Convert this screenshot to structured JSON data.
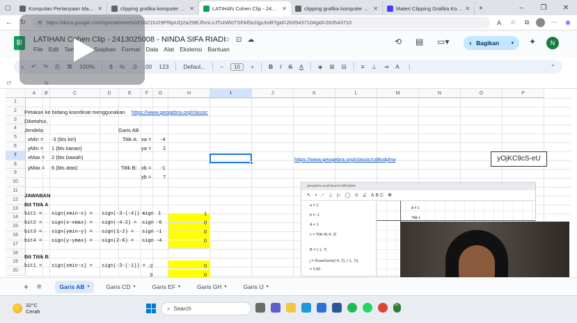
{
  "browser": {
    "tabs": [
      {
        "title": "Kumpulan Pertanyaan Materi",
        "color": "#5f6368"
      },
      {
        "title": "clipping grafika komputer - G",
        "color": "#5f6368"
      },
      {
        "title": "LATIHAN Cohen Clip - 24130",
        "color": "#0f9d58"
      },
      {
        "title": "clipping grafika komputer per",
        "color": "#5f6368"
      },
      {
        "title": "Materi Clipping Grafika Komp",
        "color": "#4a3aff"
      }
    ],
    "url": "https://docs.google.com/spreadsheets/d/1N21lU29PlNpUQ2a29tEJhmLnJTuIWloTSFAf0a1lgc/edit?gid=263543710#gid=263543710"
  },
  "sheets": {
    "title": "LATIHAN Cohen Clip - 2413025008 - NINDA SIFA RIADI",
    "menu": [
      "File",
      "Edit",
      "Tampilan",
      "Sisipkan",
      "Format",
      "Data",
      "Alat",
      "Ekstensi",
      "Bantuan"
    ],
    "share_label": "Bagikan",
    "avatar_letter": "N",
    "toolbar": {
      "zoom": "100%",
      "currency": "$",
      "percent": "%",
      "dec_less": ".0",
      "dec_more": ".00",
      "num_format": "123",
      "font": "Defaul...",
      "font_size": "10"
    },
    "name_box": "I7",
    "fx": "fx"
  },
  "columns": [
    {
      "label": "",
      "w": 29
    },
    {
      "label": "A",
      "w": 25
    },
    {
      "label": "B",
      "w": 10
    },
    {
      "label": "C",
      "w": 72
    },
    {
      "label": "D",
      "w": 27
    },
    {
      "label": "E",
      "w": 32
    },
    {
      "label": "F",
      "w": 17
    },
    {
      "label": "G",
      "w": 22
    },
    {
      "label": "H",
      "w": 60
    },
    {
      "label": "I",
      "w": 60
    },
    {
      "label": "J",
      "w": 60
    },
    {
      "label": "K",
      "w": 60
    },
    {
      "label": "L",
      "w": 60
    },
    {
      "label": "M",
      "w": 60
    },
    {
      "label": "N",
      "w": 60
    },
    {
      "label": "O",
      "w": 60
    },
    {
      "label": "P",
      "w": 60
    }
  ],
  "rows": [
    "1",
    "2",
    "3",
    "4",
    "5",
    "6",
    "7",
    "8",
    "9",
    "10",
    "11",
    "12",
    "13",
    "14",
    "15",
    "16",
    "17",
    "18",
    "19",
    "20"
  ],
  "cells": {
    "r2": "Petakan ke bidang koordinat menggunakan",
    "r2_link": "https://www.geogebra.org/classic",
    "r3": "Diketahui,",
    "r4a": "Jendela:",
    "r4b": "Garis  AB",
    "r5a": "xMin =",
    "r5b": "-3 (bts kiri)",
    "r5c": "Titik A:",
    "r5d": "xa =",
    "r5e": "-4",
    "r6a": "yMin =",
    "r6b": "1 (bts kanan)",
    "r6d": "ya =",
    "r6e": "2",
    "r7a": "xMax =",
    "r7b": "2 (bts bawah)",
    "r7_link": "https://www.geogebra.org/classic/cd8vdphw",
    "r8a": "yMax =",
    "r8b": "6 (bts atas)",
    "r8c": "Titik B:",
    "r8d": "xb =",
    "r8e": "-1",
    "r9d": "yb =",
    "r9e": "7",
    "r11": "JAWABAN",
    "r12": "Bit Titik A",
    "bitA": [
      {
        "a": "bit1 =",
        "b": "sign(xmin-x) =",
        "c": "sign(-3-(-4)) =",
        "d": "sign",
        "e": "1",
        "h": "1"
      },
      {
        "a": "bit2 =",
        "b": "sign(x-xmax) =",
        "c": "sign(-4-2) =",
        "d": "sign",
        "e": "-6",
        "h": "0"
      },
      {
        "a": "bit3 =",
        "b": "sign(ymin-y) =",
        "c": "sign(1-2) =",
        "d": "sign",
        "e": "-1",
        "h": "0"
      },
      {
        "a": "bit4 =",
        "b": "sign(y-ymax) =",
        "c": "sign(2-6) =",
        "d": "sign",
        "e": "-4",
        "h": "0"
      }
    ],
    "r18": "Bit Titik B",
    "bitB1": {
      "a": "bit1 =",
      "b": "sign(xmin-x) =",
      "c": "sign(-3-(-1)) =",
      "e": "-2",
      "h": "0"
    },
    "bitB2": {
      "e": "3",
      "h": "0"
    }
  },
  "watermark": "yOjKC9cS-eU",
  "geogebra": {
    "url": "geogebra.org/classic/cd8vdphw",
    "algebra": [
      "a = 1",
      "b = -1",
      "A = 1",
      "c = Titik A(-4, 2)",
      "B = (-1, 7)",
      "j = RuasGaris((-4, 2), (-1, 7))",
      "= 5.83"
    ],
    "point_label": "A = 1",
    "graph_label": "Titik 1"
  },
  "sheet_tabs": [
    "Garis AB",
    "Garis CD",
    "Garis EF",
    "Garis GH",
    "Garis IJ"
  ],
  "taskbar": {
    "temp": "32°C",
    "condition": "Cerah",
    "search": "Search",
    "badge": "57"
  }
}
